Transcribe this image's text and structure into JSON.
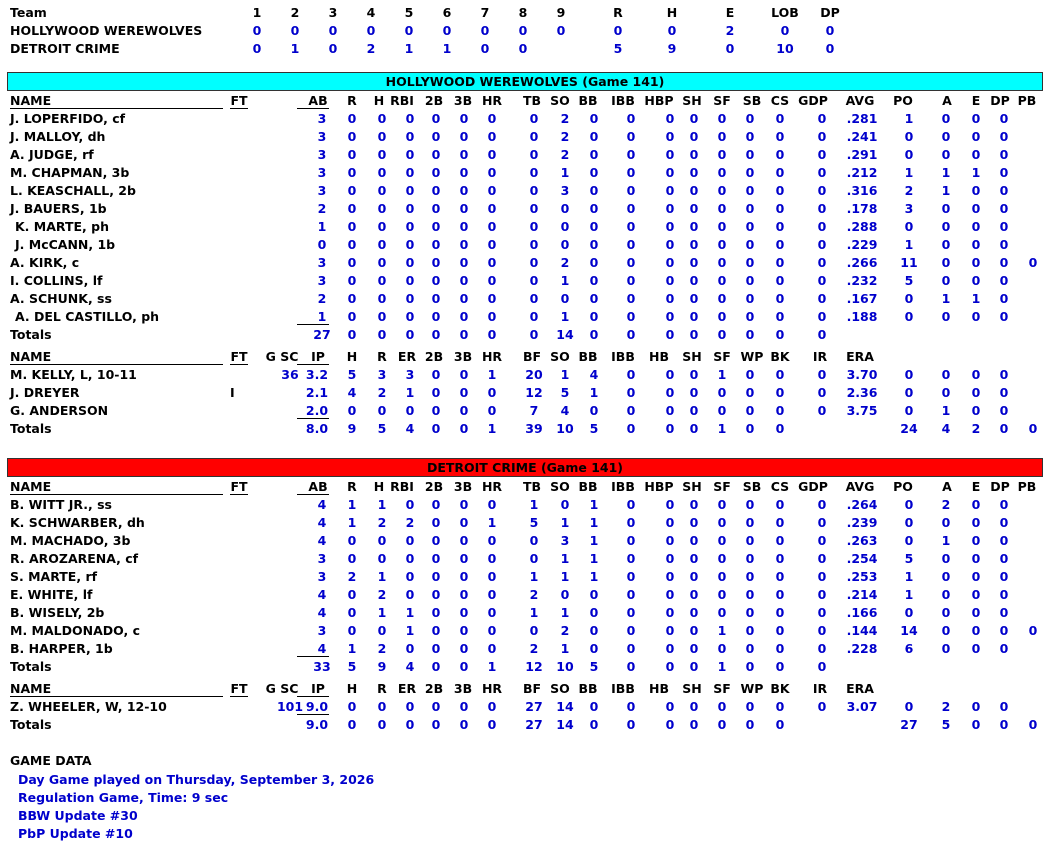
{
  "colors": {
    "home_bar": "#00ffff",
    "away_bar": "#ff0000",
    "stat": "#0000cc",
    "label": "#000000"
  },
  "linescore": {
    "headers": [
      "Team",
      "1",
      "2",
      "3",
      "4",
      "5",
      "6",
      "7",
      "8",
      "9",
      "R",
      "H",
      "E",
      "LOB",
      "DP"
    ],
    "rows": [
      [
        "HOLLYWOOD WEREWOLVES",
        "0",
        "0",
        "0",
        "0",
        "0",
        "0",
        "0",
        "0",
        "0",
        "0",
        "0",
        "2",
        "0",
        "0"
      ],
      [
        "DETROIT CRIME",
        "0",
        "1",
        "0",
        "2",
        "1",
        "1",
        "0",
        "0",
        "",
        "5",
        "9",
        "0",
        "10",
        "0"
      ]
    ]
  },
  "teams": [
    {
      "title": "HOLLYWOOD WEREWOLVES (Game 141)",
      "bar_color": "#00ffff",
      "batting_headers": [
        "NAME",
        "FT",
        "AB",
        "R",
        "H",
        "RBI",
        "2B",
        "3B",
        "HR",
        "TB",
        "SO",
        "BB",
        "IBB",
        "HBP",
        "SH",
        "SF",
        "SB",
        "CS",
        "GDP",
        "AVG",
        "PO",
        "A",
        "E",
        "DP",
        "PB"
      ],
      "batters": [
        {
          "name": "J. LOPERFIDO, cf",
          "ft": "",
          "s": [
            "3",
            "0",
            "0",
            "0",
            "0",
            "0",
            "0",
            "0",
            "2",
            "0",
            "0",
            "0",
            "0",
            "0",
            "0",
            "0",
            "0",
            ".281",
            "1",
            "0",
            "0",
            "0",
            ""
          ]
        },
        {
          "name": "J. MALLOY, dh",
          "ft": "",
          "s": [
            "3",
            "0",
            "0",
            "0",
            "0",
            "0",
            "0",
            "0",
            "2",
            "0",
            "0",
            "0",
            "0",
            "0",
            "0",
            "0",
            "0",
            ".241",
            "0",
            "0",
            "0",
            "0",
            ""
          ]
        },
        {
          "name": "A. JUDGE, rf",
          "ft": "",
          "s": [
            "3",
            "0",
            "0",
            "0",
            "0",
            "0",
            "0",
            "0",
            "2",
            "0",
            "0",
            "0",
            "0",
            "0",
            "0",
            "0",
            "0",
            ".291",
            "0",
            "0",
            "0",
            "0",
            ""
          ]
        },
        {
          "name": "M. CHAPMAN, 3b",
          "ft": "",
          "s": [
            "3",
            "0",
            "0",
            "0",
            "0",
            "0",
            "0",
            "0",
            "1",
            "0",
            "0",
            "0",
            "0",
            "0",
            "0",
            "0",
            "0",
            ".212",
            "1",
            "1",
            "1",
            "0",
            ""
          ]
        },
        {
          "name": "L. KEASCHALL, 2b",
          "ft": "",
          "s": [
            "3",
            "0",
            "0",
            "0",
            "0",
            "0",
            "0",
            "0",
            "3",
            "0",
            "0",
            "0",
            "0",
            "0",
            "0",
            "0",
            "0",
            ".316",
            "2",
            "1",
            "0",
            "0",
            ""
          ]
        },
        {
          "name": "J. BAUERS, 1b",
          "ft": "",
          "s": [
            "2",
            "0",
            "0",
            "0",
            "0",
            "0",
            "0",
            "0",
            "0",
            "0",
            "0",
            "0",
            "0",
            "0",
            "0",
            "0",
            "0",
            ".178",
            "3",
            "0",
            "0",
            "0",
            ""
          ]
        },
        {
          "name": " K. MARTE, ph",
          "ft": "",
          "s": [
            "1",
            "0",
            "0",
            "0",
            "0",
            "0",
            "0",
            "0",
            "0",
            "0",
            "0",
            "0",
            "0",
            "0",
            "0",
            "0",
            "0",
            ".288",
            "0",
            "0",
            "0",
            "0",
            ""
          ]
        },
        {
          "name": " J. McCANN, 1b",
          "ft": "",
          "s": [
            "0",
            "0",
            "0",
            "0",
            "0",
            "0",
            "0",
            "0",
            "0",
            "0",
            "0",
            "0",
            "0",
            "0",
            "0",
            "0",
            "0",
            ".229",
            "1",
            "0",
            "0",
            "0",
            ""
          ]
        },
        {
          "name": "A. KIRK, c",
          "ft": "",
          "s": [
            "3",
            "0",
            "0",
            "0",
            "0",
            "0",
            "0",
            "0",
            "2",
            "0",
            "0",
            "0",
            "0",
            "0",
            "0",
            "0",
            "0",
            ".266",
            "11",
            "0",
            "0",
            "0",
            "0"
          ]
        },
        {
          "name": "I. COLLINS, lf",
          "ft": "",
          "s": [
            "3",
            "0",
            "0",
            "0",
            "0",
            "0",
            "0",
            "0",
            "1",
            "0",
            "0",
            "0",
            "0",
            "0",
            "0",
            "0",
            "0",
            ".232",
            "5",
            "0",
            "0",
            "0",
            ""
          ]
        },
        {
          "name": "A. SCHUNK, ss",
          "ft": "",
          "s": [
            "2",
            "0",
            "0",
            "0",
            "0",
            "0",
            "0",
            "0",
            "0",
            "0",
            "0",
            "0",
            "0",
            "0",
            "0",
            "0",
            "0",
            ".167",
            "0",
            "1",
            "1",
            "0",
            ""
          ]
        },
        {
          "name": " A. DEL CASTILLO, ph",
          "ft": "",
          "s": [
            "1",
            "0",
            "0",
            "0",
            "0",
            "0",
            "0",
            "0",
            "1",
            "0",
            "0",
            "0",
            "0",
            "0",
            "0",
            "0",
            "0",
            ".188",
            "0",
            "0",
            "0",
            "0",
            ""
          ]
        }
      ],
      "batting_totals": {
        "label": "Totals",
        "s": [
          "27",
          "0",
          "0",
          "0",
          "0",
          "0",
          "0",
          "0",
          "14",
          "0",
          "0",
          "0",
          "0",
          "0",
          "0",
          "0",
          "0",
          "",
          "",
          "",
          "",
          "",
          ""
        ]
      },
      "pitching_headers": [
        "NAME",
        "FT",
        "G SC",
        "IP",
        "H",
        "R",
        "ER",
        "2B",
        "3B",
        "HR",
        "BF",
        "SO",
        "BB",
        "IBB",
        "HB",
        "SH",
        "SF",
        "WP",
        "BK",
        "IR",
        "ERA"
      ],
      "pitchers": [
        {
          "name": "M. KELLY,  L, 10-11",
          "ft": "",
          "s": [
            "36",
            "3.2",
            "5",
            "3",
            "3",
            "0",
            "0",
            "1",
            "20",
            "1",
            "4",
            "0",
            "0",
            "0",
            "1",
            "0",
            "0",
            "0",
            "3.70",
            "0",
            "0",
            "0",
            "0",
            ""
          ]
        },
        {
          "name": "J. DREYER",
          "ft": "I",
          "s": [
            "",
            "2.1",
            "4",
            "2",
            "1",
            "0",
            "0",
            "0",
            "12",
            "5",
            "1",
            "0",
            "0",
            "0",
            "0",
            "0",
            "0",
            "0",
            "2.36",
            "0",
            "0",
            "0",
            "0",
            ""
          ]
        },
        {
          "name": "G. ANDERSON",
          "ft": "",
          "s": [
            "",
            "2.0",
            "0",
            "0",
            "0",
            "0",
            "0",
            "0",
            "7",
            "4",
            "0",
            "0",
            "0",
            "0",
            "0",
            "0",
            "0",
            "0",
            "3.75",
            "0",
            "1",
            "0",
            "0",
            ""
          ]
        }
      ],
      "pitching_totals": {
        "label": "Totals",
        "s": [
          "",
          "8.0",
          "9",
          "5",
          "4",
          "0",
          "0",
          "1",
          "39",
          "10",
          "5",
          "0",
          "0",
          "0",
          "1",
          "0",
          "0",
          "",
          "",
          "24",
          "4",
          "2",
          "0",
          "0"
        ]
      }
    },
    {
      "title": "DETROIT CRIME (Game 141)",
      "bar_color": "#ff0000",
      "batting_headers": [
        "NAME",
        "FT",
        "AB",
        "R",
        "H",
        "RBI",
        "2B",
        "3B",
        "HR",
        "TB",
        "SO",
        "BB",
        "IBB",
        "HBP",
        "SH",
        "SF",
        "SB",
        "CS",
        "GDP",
        "AVG",
        "PO",
        "A",
        "E",
        "DP",
        "PB"
      ],
      "batters": [
        {
          "name": "B. WITT JR., ss",
          "ft": "",
          "s": [
            "4",
            "1",
            "1",
            "0",
            "0",
            "0",
            "0",
            "1",
            "0",
            "1",
            "0",
            "0",
            "0",
            "0",
            "0",
            "0",
            "0",
            ".264",
            "0",
            "2",
            "0",
            "0",
            ""
          ]
        },
        {
          "name": "K. SCHWARBER, dh",
          "ft": "",
          "s": [
            "4",
            "1",
            "2",
            "2",
            "0",
            "0",
            "1",
            "5",
            "1",
            "1",
            "0",
            "0",
            "0",
            "0",
            "0",
            "0",
            "0",
            ".239",
            "0",
            "0",
            "0",
            "0",
            ""
          ]
        },
        {
          "name": "M. MACHADO, 3b",
          "ft": "",
          "s": [
            "4",
            "0",
            "0",
            "0",
            "0",
            "0",
            "0",
            "0",
            "3",
            "1",
            "0",
            "0",
            "0",
            "0",
            "0",
            "0",
            "0",
            ".263",
            "0",
            "1",
            "0",
            "0",
            ""
          ]
        },
        {
          "name": "R. AROZARENA, cf",
          "ft": "",
          "s": [
            "3",
            "0",
            "0",
            "0",
            "0",
            "0",
            "0",
            "0",
            "1",
            "1",
            "0",
            "0",
            "0",
            "0",
            "0",
            "0",
            "0",
            ".254",
            "5",
            "0",
            "0",
            "0",
            ""
          ]
        },
        {
          "name": "S. MARTE, rf",
          "ft": "",
          "s": [
            "3",
            "2",
            "1",
            "0",
            "0",
            "0",
            "0",
            "1",
            "1",
            "1",
            "0",
            "0",
            "0",
            "0",
            "0",
            "0",
            "0",
            ".253",
            "1",
            "0",
            "0",
            "0",
            ""
          ]
        },
        {
          "name": "E. WHITE, lf",
          "ft": "",
          "s": [
            "4",
            "0",
            "2",
            "0",
            "0",
            "0",
            "0",
            "2",
            "0",
            "0",
            "0",
            "0",
            "0",
            "0",
            "0",
            "0",
            "0",
            ".214",
            "1",
            "0",
            "0",
            "0",
            ""
          ]
        },
        {
          "name": "B. WISELY, 2b",
          "ft": "",
          "s": [
            "4",
            "0",
            "1",
            "1",
            "0",
            "0",
            "0",
            "1",
            "1",
            "0",
            "0",
            "0",
            "0",
            "0",
            "0",
            "0",
            "0",
            ".166",
            "0",
            "0",
            "0",
            "0",
            ""
          ]
        },
        {
          "name": "M. MALDONADO, c",
          "ft": "",
          "s": [
            "3",
            "0",
            "0",
            "1",
            "0",
            "0",
            "0",
            "0",
            "2",
            "0",
            "0",
            "0",
            "0",
            "1",
            "0",
            "0",
            "0",
            ".144",
            "14",
            "0",
            "0",
            "0",
            "0"
          ]
        },
        {
          "name": "B. HARPER, 1b",
          "ft": "",
          "s": [
            "4",
            "1",
            "2",
            "0",
            "0",
            "0",
            "0",
            "2",
            "1",
            "0",
            "0",
            "0",
            "0",
            "0",
            "0",
            "0",
            "0",
            ".228",
            "6",
            "0",
            "0",
            "0",
            ""
          ]
        }
      ],
      "batting_totals": {
        "label": "Totals",
        "s": [
          "33",
          "5",
          "9",
          "4",
          "0",
          "0",
          "1",
          "12",
          "10",
          "5",
          "0",
          "0",
          "0",
          "1",
          "0",
          "0",
          "0",
          "",
          "",
          "",
          "",
          "",
          ""
        ]
      },
      "pitching_headers": [
        "NAME",
        "FT",
        "G SC",
        "IP",
        "H",
        "R",
        "ER",
        "2B",
        "3B",
        "HR",
        "BF",
        "SO",
        "BB",
        "IBB",
        "HB",
        "SH",
        "SF",
        "WP",
        "BK",
        "IR",
        "ERA"
      ],
      "pitchers": [
        {
          "name": "Z. WHEELER,  W, 12-10",
          "ft": "",
          "s": [
            "101",
            "9.0",
            "0",
            "0",
            "0",
            "0",
            "0",
            "0",
            "27",
            "14",
            "0",
            "0",
            "0",
            "0",
            "0",
            "0",
            "0",
            "0",
            "3.07",
            "0",
            "2",
            "0",
            "0",
            ""
          ]
        }
      ],
      "pitching_totals": {
        "label": "Totals",
        "s": [
          "",
          "9.0",
          "0",
          "0",
          "0",
          "0",
          "0",
          "0",
          "27",
          "14",
          "0",
          "0",
          "0",
          "0",
          "0",
          "0",
          "0",
          "",
          "",
          "27",
          "5",
          "0",
          "0",
          "0"
        ]
      }
    }
  ],
  "game_data": {
    "heading": "GAME DATA",
    "lines": [
      "Day Game played on Thursday, September 3, 2026",
      "Regulation Game,   Time: 9 sec",
      "BBW Update #30",
      "PbP Update #10"
    ]
  }
}
